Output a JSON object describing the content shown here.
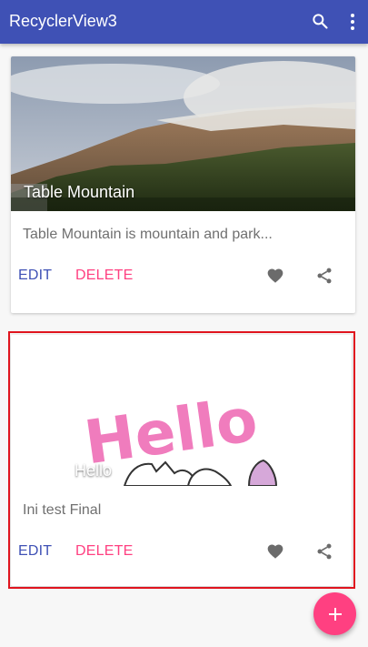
{
  "appbar": {
    "title": "RecyclerView3",
    "search_icon": "search-icon",
    "menu_icon": "overflow-menu-icon",
    "color": "#3f51b5"
  },
  "cards": [
    {
      "title": "Table Mountain",
      "description": "Table Mountain is mountain and park...",
      "edit_label": "EDIT",
      "delete_label": "DELETE",
      "favorite_icon": "heart-icon",
      "share_icon": "share-icon"
    },
    {
      "title": "Hello",
      "image_text": "Hello",
      "description": "Ini test Final",
      "edit_label": "EDIT",
      "delete_label": "DELETE",
      "favorite_icon": "heart-icon",
      "share_icon": "share-icon",
      "selected": true
    }
  ],
  "fab": {
    "icon": "plus-icon",
    "color": "#ff4081"
  },
  "colors": {
    "primary": "#3f51b5",
    "accent": "#ff4081",
    "selection_outline": "#e0141e"
  }
}
